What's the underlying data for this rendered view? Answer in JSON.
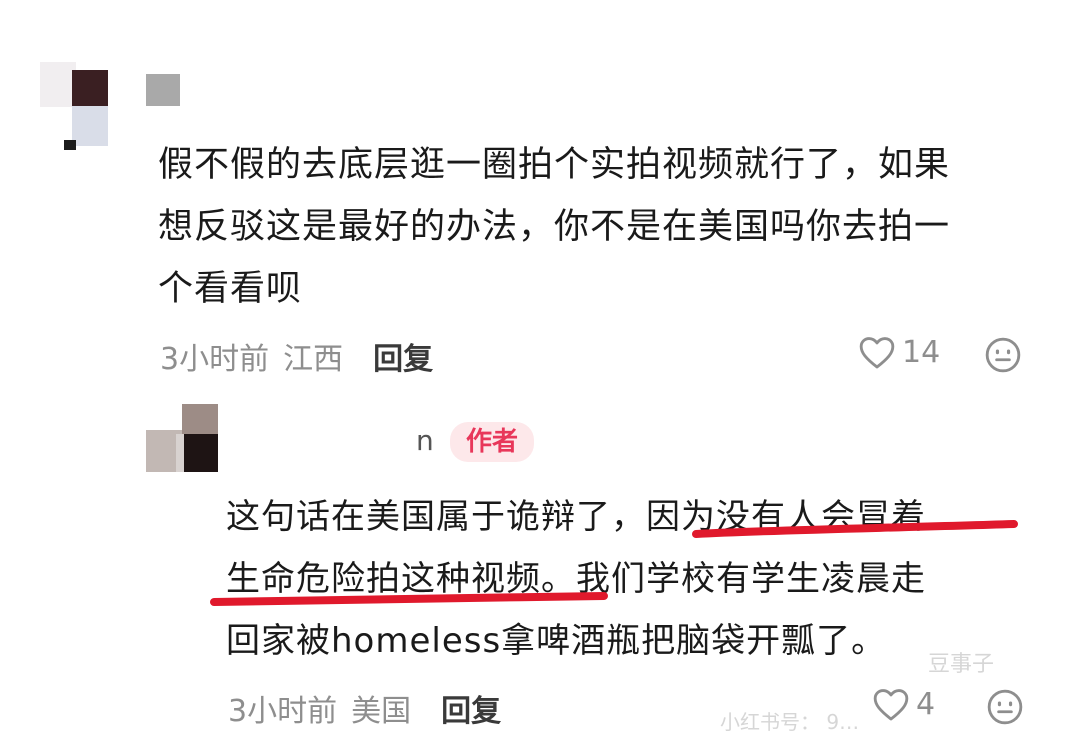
{
  "comment1": {
    "text_lines": [
      "假不假的去底层逛一圈拍个实拍视频就行了，如果",
      "想反驳这是最好的办法，你不是在美国吗你去拍一",
      "个看看呗"
    ],
    "time": "3小时前",
    "location": "江西",
    "reply_label": "回复",
    "likes": "14"
  },
  "comment2": {
    "user_fragment": "n",
    "author_tag": "作者",
    "line1_a": "这句话在美国属于诡辩了，",
    "line1_b": "因为没有人会冒着",
    "line2_a": "生命危险拍这种视频。",
    "line2_b": "我们学校有学生凌晨走",
    "line3": "回家被homeless拿啤酒瓶把脑袋开瓢了。",
    "time": "3小时前",
    "location": "美国",
    "reply_label": "回复",
    "likes": "4"
  },
  "watermark": {
    "line1": "豆事子",
    "line2": "小红书号： 9…"
  },
  "colors": {
    "underline": "#e0192c",
    "author_tag_bg": "#fde8ea",
    "author_tag_text": "#e8375a"
  }
}
